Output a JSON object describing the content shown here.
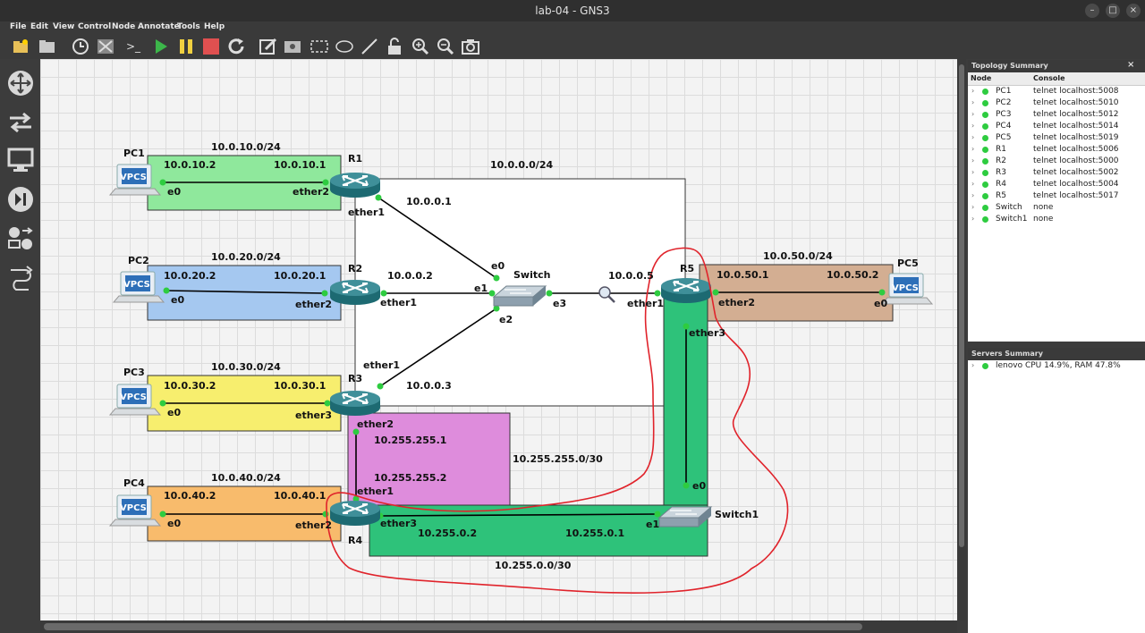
{
  "window": {
    "title": "lab-04 - GNS3"
  },
  "menu": [
    "File",
    "Edit",
    "View",
    "Control",
    "Node",
    "Annotate",
    "Tools",
    "Help"
  ],
  "toolbar_icons": [
    "new-project-icon",
    "open-project-icon",
    "snapshot-icon",
    "show-interface-labels-icon",
    "console-icon",
    "start-icon",
    "pause-icon",
    "stop-icon",
    "reload-icon",
    "add-note-icon",
    "insert-picture-icon",
    "draw-rectangle-icon",
    "draw-ellipse-icon",
    "draw-line-icon",
    "lock-icon",
    "zoom-in-icon",
    "zoom-out-icon",
    "screenshot-icon"
  ],
  "colors": {
    "accent_link_dot": "#2ecc40",
    "annotation_red": "#e0232b"
  },
  "topology": {
    "subnets": {
      "pc1": "10.0.10.0/24",
      "pc2": "10.0.20.0/24",
      "pc3": "10.0.30.0/24",
      "pc4": "10.0.40.0/24",
      "pc5": "10.0.50.0/24",
      "core": "10.0.0.0/24",
      "r3r4": "10.255.255.0/30",
      "r4r5": "10.255.0.0/30"
    },
    "nodes": {
      "pc1": "PC1",
      "pc2": "PC2",
      "pc3": "PC3",
      "pc4": "PC4",
      "pc5": "PC5",
      "r1": "R1",
      "r2": "R2",
      "r3": "R3",
      "r4": "R4",
      "r5": "R5",
      "switch": "Switch",
      "switch1": "Switch1",
      "vpcs": "VPCS"
    },
    "ips": {
      "pc1_ip": "10.0.10.2",
      "r1_lan": "10.0.10.1",
      "pc2_ip": "10.0.20.2",
      "r2_lan": "10.0.20.1",
      "pc3_ip": "10.0.30.2",
      "r3_lan": "10.0.30.1",
      "pc4_ip": "10.0.40.2",
      "r4_lan": "10.0.40.1",
      "r5_lan": "10.0.50.1",
      "pc5_ip": "10.0.50.2",
      "r1_core": "10.0.0.1",
      "r2_core": "10.0.0.2",
      "r3_core": "10.0.0.3",
      "r5_core": "10.0.0.5",
      "r3_p2p": "10.255.255.1",
      "r4_p2p": "10.255.255.2",
      "r4_p2p2": "10.255.0.2",
      "r5_p2p2": "10.255.0.1"
    },
    "ifaces": {
      "e0": "e0",
      "e1": "e1",
      "e2": "e2",
      "e3": "e3",
      "ether1": "ether1",
      "ether2": "ether2",
      "ether3": "ether3"
    }
  },
  "topology_summary": {
    "title": "Topology Summary",
    "col_node": "Node",
    "col_console": "Console",
    "rows": [
      {
        "node": "PC1",
        "console": "telnet localhost:5008"
      },
      {
        "node": "PC2",
        "console": "telnet localhost:5010"
      },
      {
        "node": "PC3",
        "console": "telnet localhost:5012"
      },
      {
        "node": "PC4",
        "console": "telnet localhost:5014"
      },
      {
        "node": "PC5",
        "console": "telnet localhost:5019"
      },
      {
        "node": "R1",
        "console": "telnet localhost:5006"
      },
      {
        "node": "R2",
        "console": "telnet localhost:5000"
      },
      {
        "node": "R3",
        "console": "telnet localhost:5002"
      },
      {
        "node": "R4",
        "console": "telnet localhost:5004"
      },
      {
        "node": "R5",
        "console": "telnet localhost:5017"
      },
      {
        "node": "Switch",
        "console": "none"
      },
      {
        "node": "Switch1",
        "console": "none"
      }
    ]
  },
  "servers_summary": {
    "title": "Servers Summary",
    "entry": "lenovo CPU 14.9%, RAM 47.8%"
  }
}
